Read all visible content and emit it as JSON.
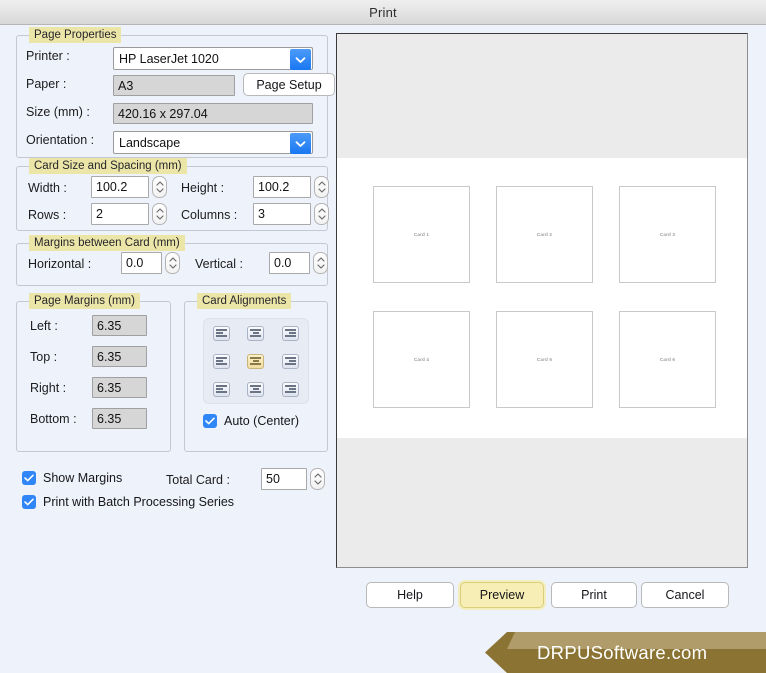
{
  "window": {
    "title": "Print"
  },
  "page_properties": {
    "legend": "Page Properties",
    "printer_label": "Printer :",
    "printer_value": "HP LaserJet 1020",
    "paper_label": "Paper :",
    "paper_value": "A3",
    "page_setup_button": "Page Setup",
    "size_label": "Size (mm) :",
    "size_value": "420.16 x 297.04",
    "orientation_label": "Orientation :",
    "orientation_value": "Landscape"
  },
  "card_size": {
    "legend": "Card Size and Spacing (mm)",
    "width_label": "Width :",
    "width_value": "100.2",
    "height_label": "Height :",
    "height_value": "100.2",
    "rows_label": "Rows :",
    "rows_value": "2",
    "columns_label": "Columns :",
    "columns_value": "3"
  },
  "margins_between": {
    "legend": "Margins between Card (mm)",
    "horizontal_label": "Horizontal :",
    "horizontal_value": "0.0",
    "vertical_label": "Vertical :",
    "vertical_value": "0.0"
  },
  "page_margins": {
    "legend": "Page Margins (mm)",
    "left_label": "Left :",
    "left_value": "6.35",
    "top_label": "Top :",
    "top_value": "6.35",
    "right_label": "Right :",
    "right_value": "6.35",
    "bottom_label": "Bottom :",
    "bottom_value": "6.35"
  },
  "card_alignments": {
    "legend": "Card Alignments",
    "auto_center_label": "Auto (Center)",
    "auto_center_checked": true,
    "selected_index": 4,
    "cells": [
      "align-top-left",
      "align-top-center",
      "align-top-right",
      "align-middle-left",
      "align-middle-center",
      "align-middle-right",
      "align-bottom-left",
      "align-bottom-center",
      "align-bottom-right"
    ]
  },
  "options": {
    "show_margins_label": "Show Margins",
    "show_margins_checked": true,
    "batch_label": "Print with Batch Processing Series",
    "batch_checked": true,
    "total_card_label": "Total Card :",
    "total_card_value": "50"
  },
  "buttons": {
    "help": "Help",
    "preview": "Preview",
    "print": "Print",
    "cancel": "Cancel"
  },
  "preview": {
    "cards": [
      "Card 1",
      "Card 2",
      "Card 3",
      "Card 4",
      "Card 5",
      "Card 6"
    ]
  },
  "brand": {
    "text": "DRPUSoftware.com",
    "color_dark": "#8b7433",
    "color_light": "#b5a374"
  },
  "colors": {
    "legend_highlight": "#ece5a8",
    "accent_blue": "#2f86f6",
    "highlight_button": "#f6eeb4",
    "panel_background": "#eef2fa"
  }
}
